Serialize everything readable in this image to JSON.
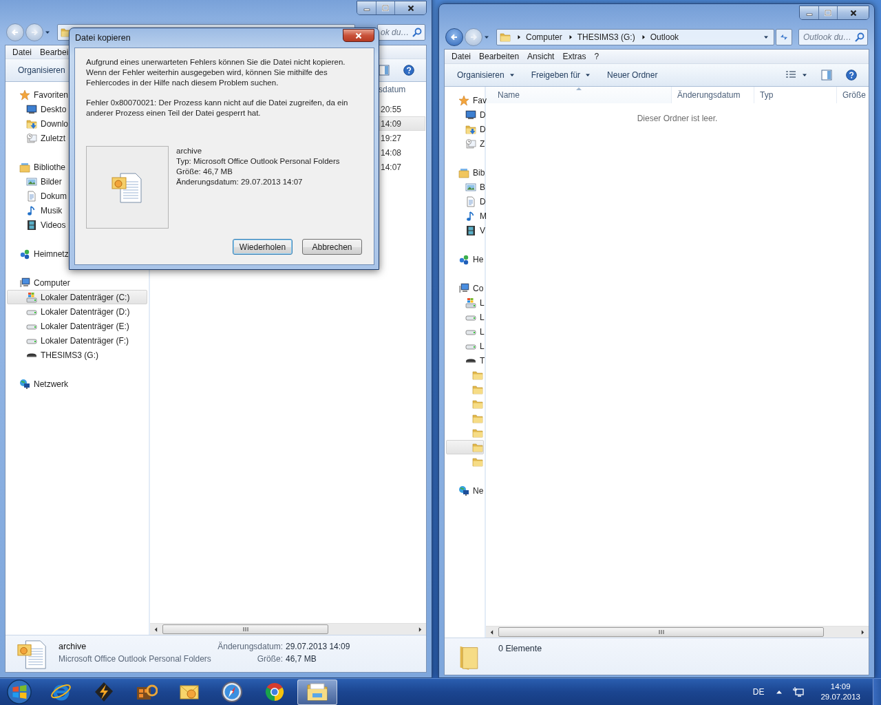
{
  "windows": [
    {
      "search": {
        "placeholder": "ok du…"
      },
      "menu": [
        "Datei",
        "Bearbei"
      ],
      "toolbar": [
        {
          "label": "Organisieren",
          "dropdown": false
        }
      ],
      "columns": [
        {
          "label": "sdatum"
        }
      ],
      "rows": [
        {
          "cells": [
            "20:55"
          ],
          "selected": false
        },
        {
          "cells": [
            "14:09"
          ],
          "selected": true
        },
        {
          "cells": [
            "19:27"
          ],
          "selected": false
        },
        {
          "cells": [
            "14:08"
          ],
          "selected": false
        },
        {
          "cells": [
            "14:07"
          ],
          "selected": false
        }
      ],
      "nav": [
        {
          "label": "Favoriten",
          "kind": "favorites",
          "selected": false,
          "children": [
            {
              "label": "Deskto",
              "kind": "desktop",
              "selected": false
            },
            {
              "label": "Downlo",
              "kind": "downloads",
              "selected": false
            },
            {
              "label": "Zuletzt",
              "kind": "recent",
              "selected": false
            }
          ]
        },
        {
          "label": "Bibliothe",
          "kind": "libraries",
          "selected": false,
          "children": [
            {
              "label": "Bilder",
              "kind": "pictures",
              "selected": false
            },
            {
              "label": "Dokum",
              "kind": "documents",
              "selected": false
            },
            {
              "label": "Musik",
              "kind": "music",
              "selected": false
            },
            {
              "label": "Videos",
              "kind": "videos",
              "selected": false
            }
          ]
        },
        {
          "label": "Heimnetz",
          "kind": "homegroup",
          "selected": false
        },
        {
          "label": "Computer",
          "kind": "computer",
          "selected": false,
          "children": [
            {
              "label": "Lokaler Datenträger (C:)",
              "kind": "system-drive",
              "selected": true
            },
            {
              "label": "Lokaler Datenträger (D:)",
              "kind": "drive",
              "selected": false
            },
            {
              "label": "Lokaler Datenträger (E:)",
              "kind": "drive",
              "selected": false
            },
            {
              "label": "Lokaler Datenträger (F:)",
              "kind": "drive",
              "selected": false
            },
            {
              "label": "THESIMS3 (G:)",
              "kind": "usb-drive",
              "selected": false
            }
          ]
        },
        {
          "label": "Netzwerk",
          "kind": "network",
          "selected": false
        }
      ],
      "details": {
        "kind": "file",
        "name": "archive",
        "type": "Microsoft Office Outlook Personal Folders",
        "fields": [
          {
            "label": "Änderungsdatum:",
            "value": "29.07.2013 14:09"
          },
          {
            "label": "Größe:",
            "value": "46,7 MB"
          }
        ]
      }
    },
    {
      "breadcrumb": [
        "Computer",
        "THESIMS3 (G:)",
        "Outlook"
      ],
      "search": {
        "placeholder": "Outlook du…"
      },
      "menu": [
        "Datei",
        "Bearbeiten",
        "Ansicht",
        "Extras",
        "?"
      ],
      "toolbar": [
        {
          "label": "Organisieren",
          "dropdown": true
        },
        {
          "label": "Freigeben für",
          "dropdown": true
        },
        {
          "label": "Neuer Ordner",
          "dropdown": false
        }
      ],
      "columns": [
        {
          "label": "Name",
          "sorted": true
        },
        {
          "label": "Änderungsdatum",
          "sorted": false
        },
        {
          "label": "Typ",
          "sorted": false
        },
        {
          "label": "Größe",
          "sorted": false
        }
      ],
      "empty_message": "Dieser Ordner ist leer.",
      "nav": [
        {
          "label": "Fav",
          "kind": "favorites",
          "selected": false,
          "children": [
            {
              "label": "D",
              "kind": "desktop",
              "selected": false
            },
            {
              "label": "D",
              "kind": "downloads",
              "selected": false
            },
            {
              "label": "Z",
              "kind": "recent",
              "selected": false
            }
          ]
        },
        {
          "label": "Bib",
          "kind": "libraries",
          "selected": false,
          "children": [
            {
              "label": "B",
              "kind": "pictures",
              "selected": false
            },
            {
              "label": "D",
              "kind": "documents",
              "selected": false
            },
            {
              "label": "M",
              "kind": "music",
              "selected": false
            },
            {
              "label": "V",
              "kind": "videos",
              "selected": false
            }
          ]
        },
        {
          "label": "He",
          "kind": "homegroup",
          "selected": false
        },
        {
          "label": "Co",
          "kind": "computer",
          "selected": false,
          "children": [
            {
              "label": "L",
              "kind": "system-drive",
              "selected": false
            },
            {
              "label": "L",
              "kind": "drive",
              "selected": false
            },
            {
              "label": "L",
              "kind": "drive",
              "selected": false
            },
            {
              "label": "L",
              "kind": "drive",
              "selected": false
            },
            {
              "label": "T",
              "kind": "usb-drive",
              "selected": false,
              "children": [
                {
                  "kind": "folder",
                  "selected": false
                },
                {
                  "kind": "folder",
                  "selected": false
                },
                {
                  "kind": "folder",
                  "selected": false
                },
                {
                  "kind": "folder",
                  "selected": false
                },
                {
                  "kind": "folder",
                  "selected": false
                },
                {
                  "kind": "folder",
                  "selected": true
                },
                {
                  "kind": "folder",
                  "selected": false
                }
              ]
            }
          ]
        },
        {
          "label": "Ne",
          "kind": "network",
          "selected": false
        }
      ],
      "details": {
        "kind": "folder",
        "count": "0 Elemente"
      }
    }
  ],
  "dialog": {
    "title": "Datei kopieren",
    "message": [
      "Aufgrund eines unerwarteten Fehlers können Sie die Datei nicht kopieren. Wenn der Fehler weiterhin ausgegeben wird, können Sie mithilfe des Fehlercodes in der Hilfe nach diesem Problem suchen.",
      "Fehler 0x80070021: Der Prozess kann nicht auf die Datei zugreifen, da ein anderer Prozess einen Teil der Datei gesperrt hat."
    ],
    "file": {
      "name": "archive",
      "lines": [
        "Typ: Microsoft Office Outlook Personal Folders",
        "Größe: 46,7 MB",
        "Änderungsdatum: 29.07.2013 14:07"
      ]
    },
    "buttons": [
      {
        "label": "Wiederholen",
        "default": true
      },
      {
        "label": "Abbrechen",
        "default": false
      }
    ]
  },
  "taskbar": {
    "apps": [
      {
        "kind": "orbit",
        "active": false
      },
      {
        "kind": "lightning",
        "active": false
      },
      {
        "kind": "film",
        "active": false
      },
      {
        "kind": "envelope",
        "active": false
      },
      {
        "kind": "compass",
        "active": false
      },
      {
        "kind": "wheel",
        "active": false
      },
      {
        "kind": "folder",
        "active": true
      }
    ],
    "language": "DE",
    "time": "14:09",
    "date": "29.07.2013"
  }
}
